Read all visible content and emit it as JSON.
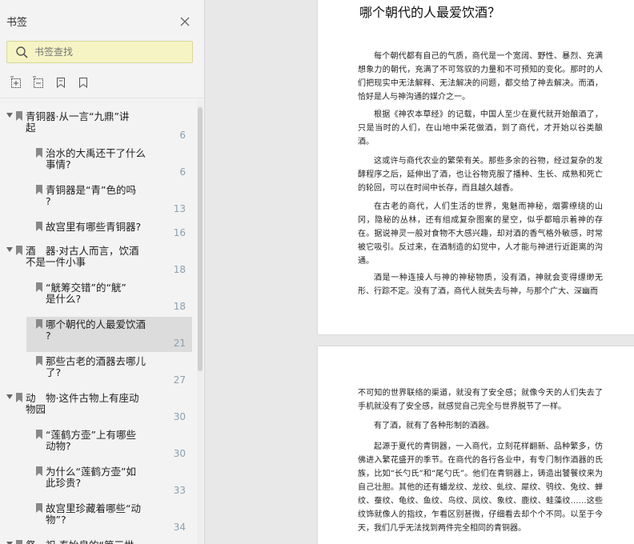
{
  "sidebar": {
    "title": "书签",
    "close_icon": "close-icon",
    "search": {
      "placeholder": "书签查找",
      "value": ""
    },
    "toolbar": [
      "add-bookmark-icon",
      "collapse-all-icon",
      "bookmark-icon",
      "bookmark-remove-icon"
    ],
    "items": [
      {
        "title": "青铜器·从一言“九鼎”讲\n起",
        "page": "6",
        "level": 0
      },
      {
        "title": "治水的大禹还干了什么\n事情?",
        "page": "6",
        "level": 1
      },
      {
        "title": "青铜器是“青”色的吗\n?",
        "page": "13",
        "level": 1
      },
      {
        "title": "故宫里有哪些青铜器?",
        "page": "16",
        "level": 1
      },
      {
        "title": "酒　器·对古人而言，饮酒\n不是一件小事",
        "page": "18",
        "level": 0
      },
      {
        "title": "“觥筹交错”的“觥”\n是什么?",
        "page": "18",
        "level": 1
      },
      {
        "title": "哪个朝代的人最爱饮酒\n?",
        "page": "21",
        "level": 1,
        "selected": true
      },
      {
        "title": "那些古老的酒器去哪儿\n了?",
        "page": "27",
        "level": 1
      },
      {
        "title": "动　物·这件古物上有座动\n物园",
        "page": "30",
        "level": 0
      },
      {
        "title": "“莲鹤方壶”上有哪些\n动物?",
        "page": "30",
        "level": 1
      },
      {
        "title": "为什么“莲鹤方壶”如\n此珍贵?",
        "page": "33",
        "level": 1
      },
      {
        "title": "故宫里珍藏着哪些“动\n物”?",
        "page": "34",
        "level": 1
      },
      {
        "title": "祭　祀·秦始皇的“第三世",
        "page": "",
        "level": 0
      }
    ]
  },
  "document": {
    "page1": {
      "heading": "哪个朝代的人最爱饮酒？",
      "paragraphs": [
        "每个朝代都有自己的气质，商代是一个宽阔、野性、暴烈、充满想象力的朝代，充满了不可驾驭的力量和不可预知的变化。那时的人们把现实中无法解释、无法解决的问题，都交给了神去解决。而酒，恰好是人与神沟通的媒介之一。",
        "根据《神农本草经》的记载，中国人至少在夏代就开始酿酒了，只是当时的人们，在山地中采花做酒，到了商代，才开始以谷类酿酒。",
        "这或许与商代农业的繁荣有关。那些多余的谷物，经过复杂的发酵程序之后，延伸出了酒，也让谷物克服了播种、生长、成熟和死亡的轮回，可以在时间中长存，而且越久越香。",
        "在古老的商代，人们生活的世界，鬼魅而神秘，烟雾缭绕的山冈，隐秘的丛林，还有组成复杂图案的星空，似乎都暗示着神的存在。据说神灵一般对食物不大感兴趣，却对酒的香气格外敏感，时常被它吸引。反过来，在酒制造的幻觉中，人才能与神进行近距离的沟通。",
        "酒是一种连接人与神的神秘物质，没有酒，神就会变得缥缈无形、行踪不定。没有了酒，商代人就失去与神，与那个广大、深幽而"
      ]
    },
    "page2": {
      "paragraphs": [
        "不可知的世界联络的渠道，就没有了安全感；就像今天的人们失去了手机就没有了安全感，就感觉自己完全与世界脱节了一样。",
        "有了酒，就有了各种形制的酒器。",
        "起源于夏代的青铜器，一入商代，立刻花样翻新、品种繁多，仿佛进入繁花盛开的季节。在商代的各行各业中，有专门制作酒器的氏族，比如“长勺氏”和“尾勺氏”。他们在青铜器上，铸造出饕餮纹来为自己壮胆。其他的还有蟠龙纹、龙纹、虬纹、犀纹、鸮纹、兔纹、蝉纹、蚕纹、龟纹、鱼纹、鸟纹、凤纹、象纹、鹿纹、蛙藻纹……这些纹饰就像人的指纹，乍看区别甚微，仔细看去却个个不同。以至于今天，我们几乎无法找到两件完全相同的青铜器。"
      ]
    }
  }
}
